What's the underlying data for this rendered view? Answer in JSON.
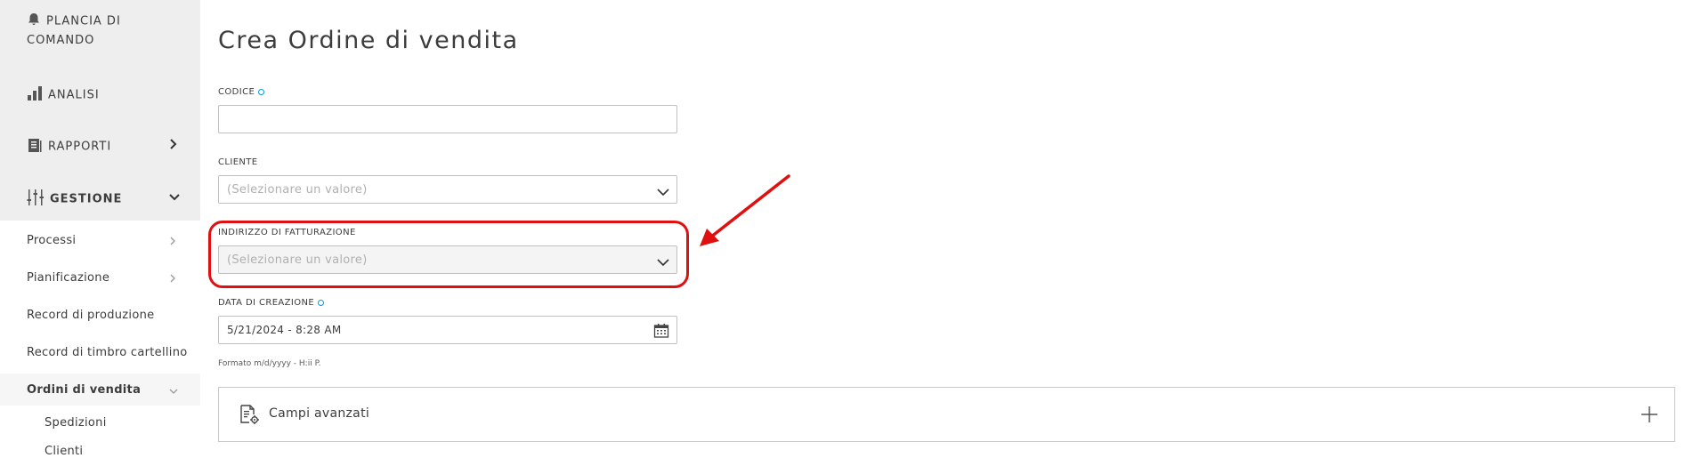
{
  "sidebar": {
    "items": [
      {
        "label": "PLANCIA DI",
        "label2": "COMANDO",
        "icon": "bell-icon"
      },
      {
        "label": "ANALISI",
        "icon": "bar-chart-icon"
      },
      {
        "label": "RAPPORTI",
        "icon": "report-icon"
      },
      {
        "label": "GESTIONE",
        "icon": "sliders-icon"
      }
    ],
    "sub_items": [
      {
        "label": "Processi"
      },
      {
        "label": "Pianificazione"
      },
      {
        "label": "Record di produzione"
      },
      {
        "label": "Record di timbro cartellino"
      },
      {
        "label": "Ordini di vendita"
      }
    ],
    "sub_sub_items": [
      {
        "label": "Spedizioni"
      },
      {
        "label": "Clienti"
      }
    ]
  },
  "page": {
    "title": "Crea Ordine di vendita"
  },
  "form": {
    "codice": {
      "label": "CODICE",
      "value": ""
    },
    "cliente": {
      "label": "CLIENTE",
      "placeholder": "(Selezionare un valore)"
    },
    "indirizzo": {
      "label": "INDIRIZZO DI FATTURAZIONE",
      "placeholder": "(Selezionare un valore)"
    },
    "data": {
      "label": "DATA DI CREAZIONE",
      "value": "5/21/2024 - 8:28 AM",
      "hint": "Formato m/d/yyyy - H:ii P."
    },
    "advanced": {
      "label": "Campi avanzati"
    }
  },
  "colors": {
    "accent": "#0696d7",
    "annotation": "#e01010",
    "sidebar_bg": "#eeeeee"
  }
}
